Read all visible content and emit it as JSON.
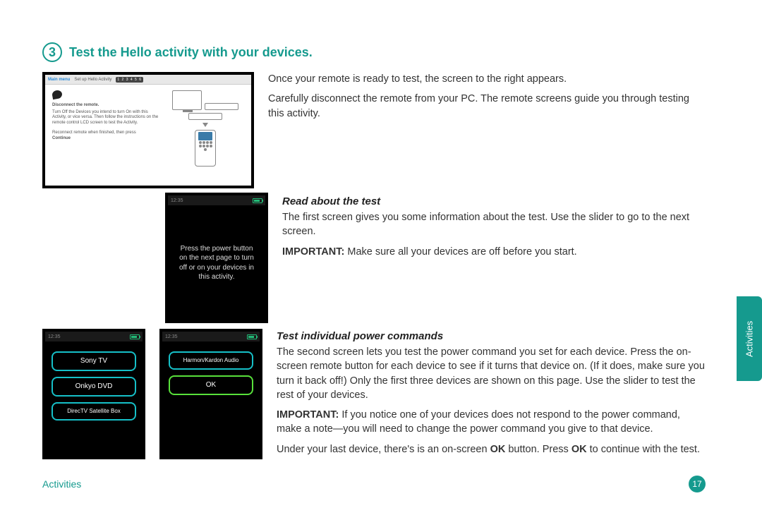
{
  "step": {
    "number": "3",
    "title": "Test the Hello activity with your devices."
  },
  "intro": {
    "p1": "Once your remote is ready to test, the screen to the right appears.",
    "p2": "Carefully disconnect the remote from your PC. The remote screens guide you through testing this activity."
  },
  "pc": {
    "main_menu": "Main menu",
    "setup": "Set up Hello Activity",
    "steps_badge": "1 2 3 4 5 6",
    "disconnect": "Disconnect the remote.",
    "body": "Turn Off the Devices you intend to turn On with this Activity, or vice versa. Then follow the instructions on the remote control LCD screen to test the Activity.",
    "reconnect": "Reconnect remote when finished, then press",
    "continue": "Continue"
  },
  "remote_time": "12:35",
  "section1": {
    "heading": "Read about the test",
    "p1": "The first screen gives you some information about the test. Use the slider to go to the next screen.",
    "important_label": "IMPORTANT:",
    "important_text": " Make sure all your devices are off before you start.",
    "screen_msg": "Press the power button on the next page to turn off or on your devices in this activity."
  },
  "section2": {
    "heading": "Test individual power commands",
    "p1": "The second screen lets you test the power command you set for each device. Press the on-screen remote button for each device to see if it turns that device on. (If it does, make sure you turn it back off!) Only the first three devices are shown on this page. Use the slider to test the rest of your devices.",
    "important_label": "IMPORTANT:",
    "important_text": " If you notice one of your devices does not respond to the power command, make a note—you will need to change the power command you give to that device.",
    "p2_a": "Under your last device, there's is an on-screen ",
    "p2_b": " button. Press ",
    "p2_c": " to continue with the test.",
    "ok_word": "OK",
    "screenA": {
      "btn1": "Sony TV",
      "btn2": "Onkyo DVD",
      "btn3": "DirecTV Satellite Box"
    },
    "screenB": {
      "btn1": "Harmon/Kardon Audio",
      "btn2": "OK"
    }
  },
  "side_tab": "Activities",
  "footer": {
    "section": "Activities",
    "page": "17"
  }
}
